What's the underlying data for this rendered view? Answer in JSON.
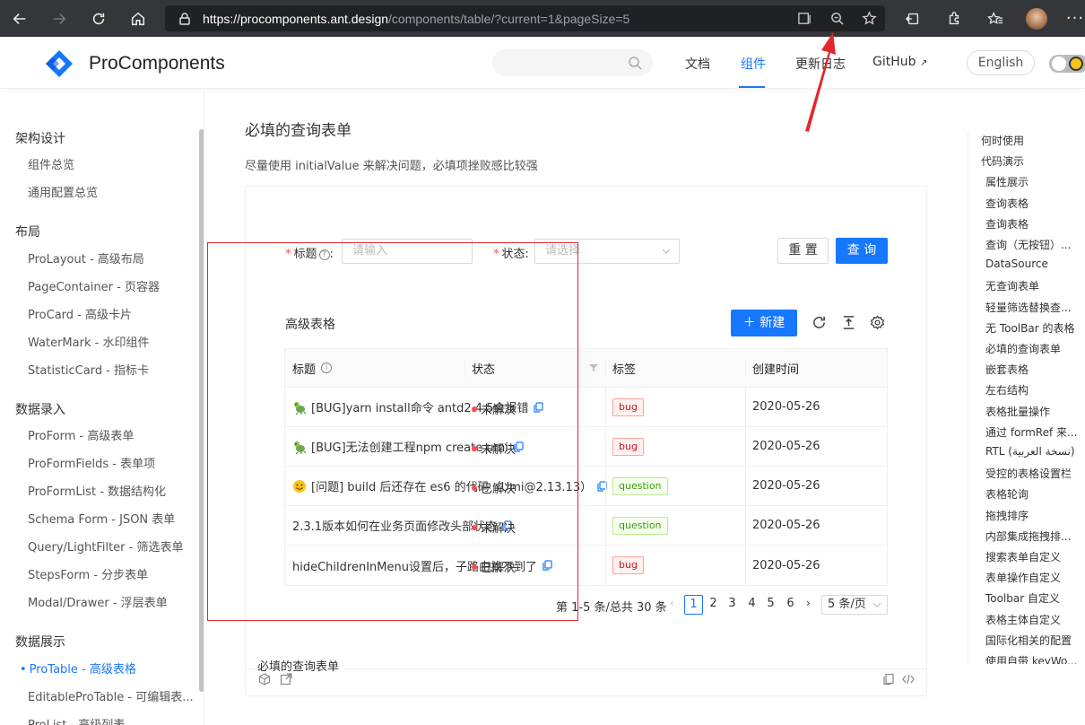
{
  "browser": {
    "url_host": "https://procomponents.ant.design",
    "url_path": "/components/table/?current=1&pageSize=5"
  },
  "header": {
    "brand": "ProComponents",
    "menu": [
      "文档",
      "组件",
      "更新日志",
      "GitHub"
    ],
    "active_menu_index": 1,
    "lang_button": "English",
    "accent_color": "#1677ff"
  },
  "sidebar": {
    "groups": [
      {
        "title": "架构设计",
        "items": [
          "组件总览",
          "通用配置总览"
        ]
      },
      {
        "title": "布局",
        "items": [
          "ProLayout - 高级布局",
          "PageContainer - 页容器",
          "ProCard - 高级卡片",
          "WaterMark - 水印组件",
          "StatisticCard - 指标卡"
        ]
      },
      {
        "title": "数据录入",
        "items": [
          "ProForm - 高级表单",
          "ProFormFields - 表单项",
          "ProFormList - 数据结构化",
          "Schema Form - JSON 表单",
          "Query/LightFilter - 筛选表单",
          "StepsForm - 分步表单",
          "Modal/Drawer - 浮层表单"
        ]
      },
      {
        "title": "数据展示",
        "items": [
          "ProTable - 高级表格",
          "EditableProTable - 可编辑表...",
          "ProList - 高级列表"
        ]
      }
    ],
    "active_item": "ProTable - 高级表格"
  },
  "main": {
    "title": "必填的查询表单",
    "description": "尽量使用 initialValue 来解决问题，必填项挫败感比较强",
    "form": {
      "title_label": "标题",
      "title_placeholder": "请输入",
      "status_label": "状态:",
      "status_placeholder": "请选择",
      "reset_label": "重 置",
      "query_label": "查 询"
    },
    "table": {
      "title": "高级表格",
      "new_button": "新建",
      "columns": [
        "标题",
        "状态",
        "标签",
        "创建时间"
      ],
      "rows": [
        {
          "title": "[BUG]yarn install命令 antd2.4.5会报错",
          "status": "未解决",
          "tag": "bug",
          "date": "2020-05-26",
          "emoji": "bug"
        },
        {
          "title": "[BUG]无法创建工程npm create umi",
          "status": "未解决",
          "tag": "bug",
          "date": "2020-05-26",
          "emoji": "bug"
        },
        {
          "title": "[问题] build 后还存在 es6 的代码（Umi@2.13.13）",
          "status": "已解决",
          "tag": "question",
          "date": "2020-05-26",
          "emoji": "smile"
        },
        {
          "title": "2.3.1版本如何在业务页面修改头部状态",
          "status": "未解决",
          "tag": "question",
          "date": "2020-05-26",
          "emoji": ""
        },
        {
          "title": "hideChildrenInMenu设置后，子路由找不到了",
          "status": "已解决",
          "tag": "bug",
          "date": "2020-05-26",
          "emoji": ""
        }
      ]
    },
    "pagination": {
      "total_text": "第 1-5 条/总共 30 条",
      "pages": [
        "1",
        "2",
        "3",
        "4",
        "5",
        "6"
      ],
      "current": "1",
      "page_size": "5 条/页"
    },
    "demo_caption": "必填的查询表单"
  },
  "toc": {
    "items": [
      {
        "label": "何时使用",
        "level": 1
      },
      {
        "label": "代码演示",
        "level": 1
      },
      {
        "label": "属性展示",
        "level": 2
      },
      {
        "label": "查询表格",
        "level": 2
      },
      {
        "label": "查询表格",
        "level": 2
      },
      {
        "label": "查询（无按钮）...",
        "level": 2
      },
      {
        "label": "DataSource",
        "level": 2
      },
      {
        "label": "无查询表单",
        "level": 2
      },
      {
        "label": "轻量筛选替换查...",
        "level": 2
      },
      {
        "label": "无 ToolBar 的表格",
        "level": 2
      },
      {
        "label": "必填的查询表单",
        "level": 2
      },
      {
        "label": "嵌套表格",
        "level": 2
      },
      {
        "label": "左右结构",
        "level": 2
      },
      {
        "label": "表格批量操作",
        "level": 2
      },
      {
        "label": "通过 formRef 来...",
        "level": 2
      },
      {
        "label": "RTL (نسخة العربية)",
        "level": 2
      },
      {
        "label": "受控的表格设置栏",
        "level": 2
      },
      {
        "label": "表格轮询",
        "level": 2
      },
      {
        "label": "拖拽排序",
        "level": 2
      },
      {
        "label": "内部集成拖拽排...",
        "level": 2
      },
      {
        "label": "搜索表单自定义",
        "level": 2
      },
      {
        "label": "表单操作自定义",
        "level": 2
      },
      {
        "label": "Toolbar 自定义",
        "level": 2
      },
      {
        "label": "表格主体自定义",
        "level": 2
      },
      {
        "label": "国际化相关的配置",
        "level": 2
      },
      {
        "label": "使用自带 keyWo...",
        "level": 2
      }
    ]
  }
}
